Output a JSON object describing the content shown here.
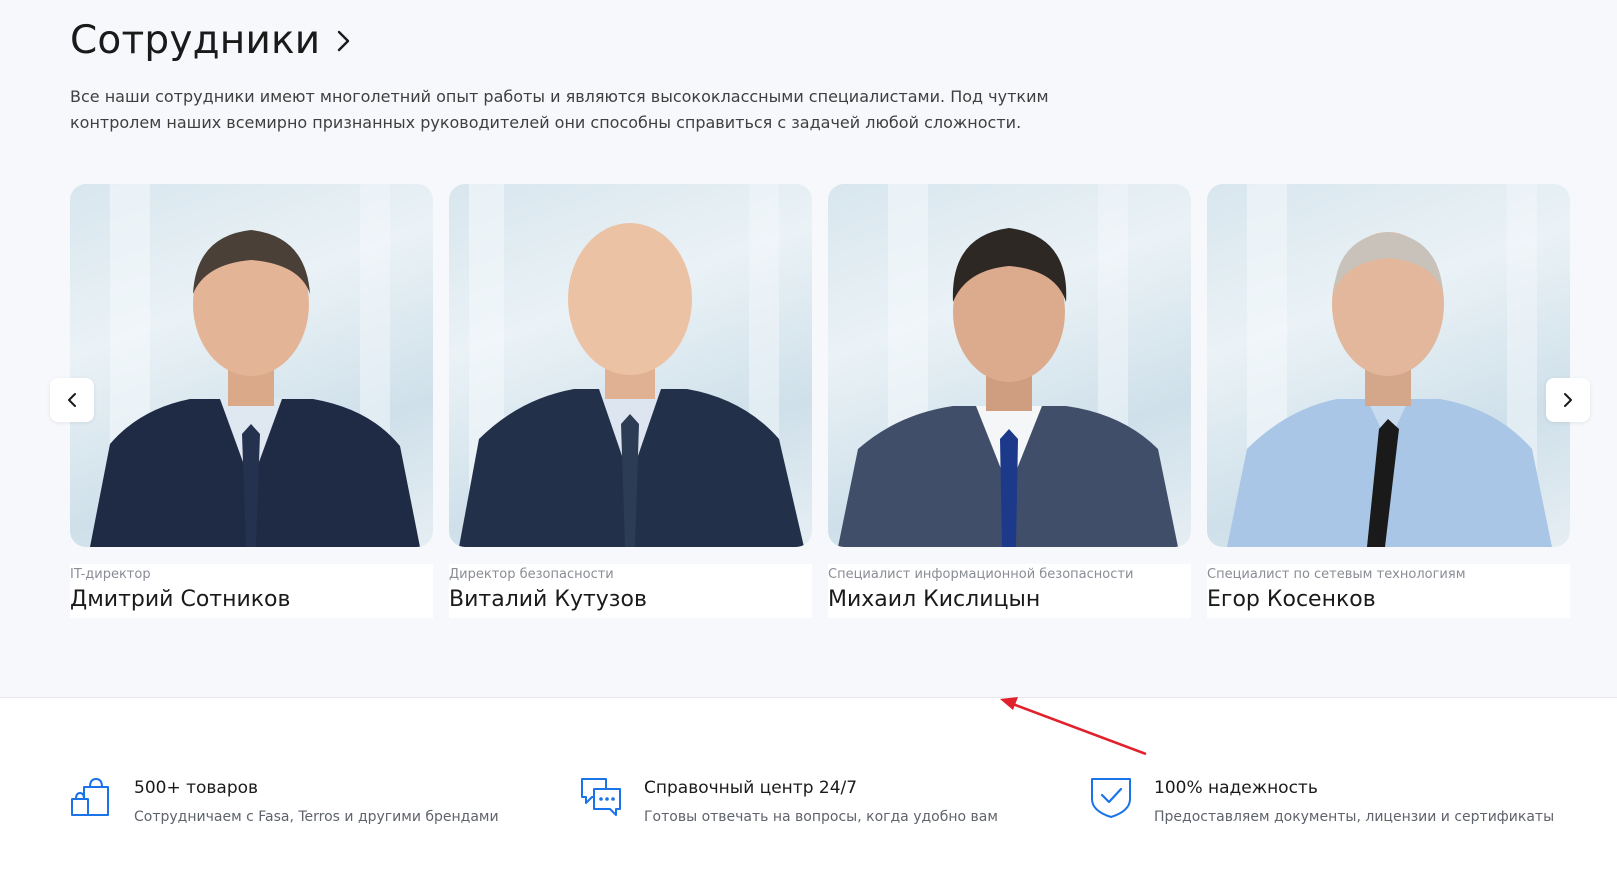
{
  "staff": {
    "title": "Сотрудники",
    "description_line1": "Все наши сотрудники имеют многолетний опыт работы и являются высококлассными специалистами. Под чутким",
    "description_line2": "контролем наших всемирно признанных руководителей они способны справиться с задачей любой сложности.",
    "cards": [
      {
        "role": "IT-директор",
        "name": "Дмитрий Сотников"
      },
      {
        "role": "Директор безопасности",
        "name": "Виталий Кутузов"
      },
      {
        "role": "Специалист информационной безопасности",
        "name": "Михаил Кислицын"
      },
      {
        "role": "Специалист по сетевым технологиям",
        "name": "Егор Косенков"
      }
    ],
    "prev_icon": "chevron-left-icon",
    "next_icon": "chevron-right-icon"
  },
  "features": [
    {
      "icon": "shopping-bag-icon",
      "title": "500+ товаров",
      "subtitle": "Сотрудничаем с Fasa, Terros и другими брендами"
    },
    {
      "icon": "chat-bubbles-icon",
      "title": "Справочный центр 24/7",
      "subtitle": "Готовы отвечать на вопросы, когда удобно вам"
    },
    {
      "icon": "shield-check-icon",
      "title": "100% надежность",
      "subtitle": "Предоставляем документы, лицензии и сертификаты"
    }
  ],
  "colors": {
    "accent": "#1a73e8",
    "annotation_arrow": "#e0202a",
    "section_bg": "#f7f8fb"
  }
}
